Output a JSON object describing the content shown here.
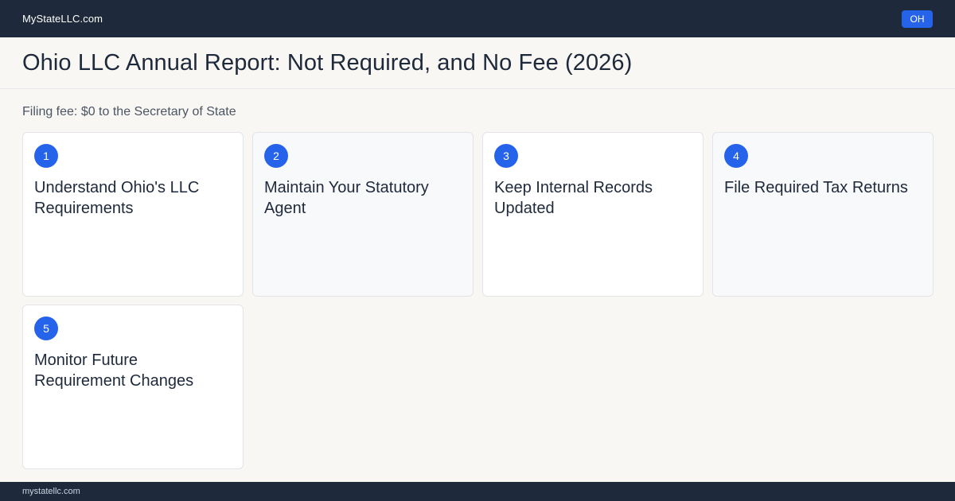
{
  "header": {
    "brand": "MyStateLLC.com",
    "state_badge": "OH"
  },
  "title": "Ohio LLC Annual Report: Not Required, and No Fee (2026)",
  "fee_line": "Filing fee: $0 to the Secretary of State",
  "steps": [
    {
      "number": "1",
      "title": "Understand Ohio's LLC Requirements"
    },
    {
      "number": "2",
      "title": "Maintain Your Statutory Agent"
    },
    {
      "number": "3",
      "title": "Keep Internal Records Updated"
    },
    {
      "number": "4",
      "title": "File Required Tax Returns"
    },
    {
      "number": "5",
      "title": "Monitor Future Requirement Changes"
    }
  ],
  "footer": {
    "text": "mystatellc.com"
  },
  "colors": {
    "navy": "#1e293b",
    "accent": "#2563eb",
    "page_bg": "#f8f7f3"
  }
}
